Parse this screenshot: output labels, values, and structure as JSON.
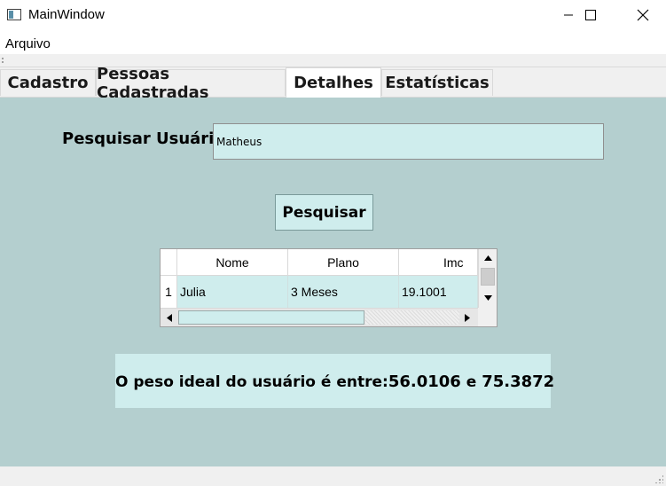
{
  "window": {
    "title": "MainWindow",
    "controls": {
      "minimize": "—",
      "maximize": "☐",
      "close": "✕"
    }
  },
  "menu": {
    "items": [
      "Arquivo"
    ]
  },
  "tabs": [
    {
      "label": "Cadastro",
      "active": false
    },
    {
      "label": "Pessoas Cadastradas",
      "active": false
    },
    {
      "label": "Detalhes",
      "active": true
    },
    {
      "label": "Estatísticas",
      "active": false
    }
  ],
  "search": {
    "label": "Pesquisar Usuário:",
    "value": "Matheus",
    "button_label": "Pesquisar"
  },
  "table": {
    "columns": [
      "Nome",
      "Plano",
      "Imc"
    ],
    "rows": [
      {
        "index": "1",
        "cells": [
          "Julia",
          "3 Meses",
          "19.1001"
        ]
      }
    ]
  },
  "ideal_weight": {
    "prefix": "O peso ideal do usuário é entre:",
    "min": "56.0106",
    "connector": " e ",
    "max": "75.3872"
  },
  "colors": {
    "background": "#b4cfcf",
    "field": "#cfeded"
  }
}
